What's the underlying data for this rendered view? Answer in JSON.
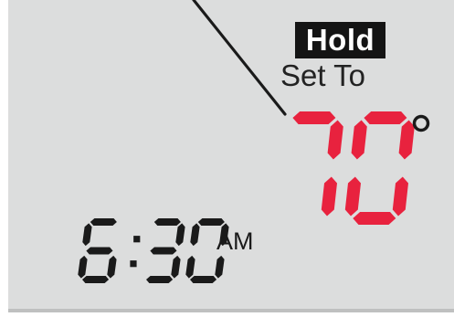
{
  "display": {
    "mode_badge": "Hold",
    "setpoint_label": "Set To",
    "setpoint_value": "70",
    "setpoint_unit_symbol": "°",
    "clock_time": "6:30",
    "clock_period": "AM"
  },
  "colors": {
    "lcd_background": "#dcdddd",
    "setpoint_digits": "#e8223e",
    "clock_digits": "#1a1a1a",
    "badge_background": "#141414",
    "badge_text": "#ffffff"
  },
  "icons": {
    "pointer": "callout-line"
  }
}
